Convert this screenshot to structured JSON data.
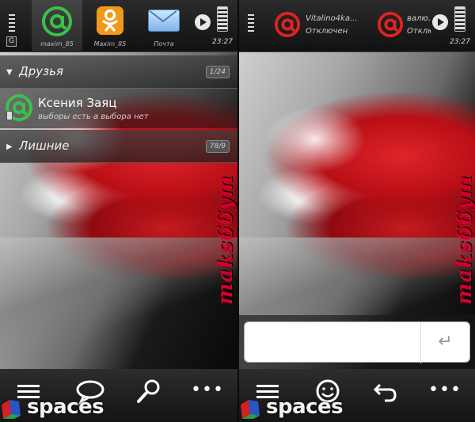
{
  "left_screen": {
    "tabs": [
      {
        "label": "maxim_85",
        "icon": "mailru-at-icon"
      },
      {
        "label": "Maxim_85",
        "icon": "odnoklassniki-icon"
      },
      {
        "label": "Почта",
        "icon": "envelope-icon"
      }
    ],
    "network_mode": "G",
    "time": "23:27",
    "groups": [
      {
        "name": "Друзья",
        "count": "1/24",
        "expanded": true
      },
      {
        "name": "Лишние",
        "count": "78/9",
        "expanded": false
      }
    ],
    "contact": {
      "name": "Ксения Заяц",
      "status": "выборы есть а выбора нет"
    },
    "watermark": "maks66ym"
  },
  "right_screen": {
    "chat_tabs": [
      {
        "title": "Vitalino4ka...",
        "status": "Отключен"
      },
      {
        "title": "валю...",
        "status": "Отклю..."
      }
    ],
    "time": "23:27",
    "watermark": "maks66ym",
    "send_glyph": "↵"
  },
  "bottom_logo": "spaces",
  "colors": {
    "accent_green": "#3cc04a",
    "accent_red": "#e02222",
    "ok_orange": "#f19a1a",
    "watermark": "#d1002b"
  }
}
